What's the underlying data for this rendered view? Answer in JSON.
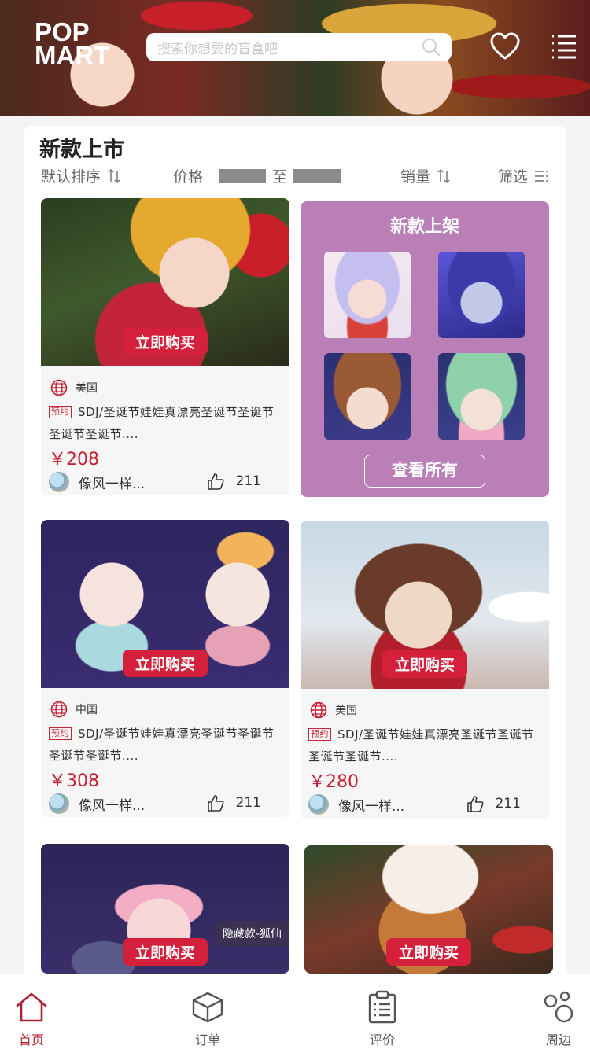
{
  "header": {
    "logo_line1": "POP",
    "logo_line2": "MART",
    "search_placeholder": "搜索你想要的盲盒吧",
    "icons": [
      "search-icon",
      "heart-icon",
      "menu-icon"
    ]
  },
  "section": {
    "title": "新款上市"
  },
  "filters": {
    "default_sort": "默认排序",
    "price": "价格",
    "price_to": "至",
    "sales": "销量",
    "filter": "筛选"
  },
  "products": [
    {
      "country": "美国",
      "tag": "预约",
      "description": "SDJ/圣诞节娃娃真漂亮圣诞节圣诞节圣诞节圣诞节....",
      "price": "￥208",
      "user": "像风一样...",
      "likes": "211",
      "buy_label": "立即购买"
    },
    {
      "country": "中国",
      "tag": "预约",
      "description": "SDJ/圣诞节娃娃真漂亮圣诞节圣诞节圣诞节圣诞节....",
      "price": "￥308",
      "user": "像风一样...",
      "likes": "211",
      "buy_label": "立即购买"
    },
    {
      "country": "美国",
      "tag": "预约",
      "description": "SDJ/圣诞节娃娃真漂亮圣诞节圣诞节圣诞节圣诞节....",
      "price": "￥280",
      "user": "像风一样...",
      "likes": "211",
      "buy_label": "立即购买"
    },
    {
      "buy_label": "立即购买",
      "badge": "隐藏款-狐仙"
    },
    {
      "buy_label": "立即购买"
    }
  ],
  "promo": {
    "title": "新款上架",
    "view_all": "查看所有"
  },
  "tabbar": {
    "items": [
      {
        "label": "首页",
        "icon": "home-icon",
        "active": true
      },
      {
        "label": "订单",
        "icon": "box-icon",
        "active": false
      },
      {
        "label": "评价",
        "icon": "clipboard-icon",
        "active": false
      },
      {
        "label": "周边",
        "icon": "circles-icon",
        "active": false
      }
    ]
  },
  "colors": {
    "accent": "#d4203a",
    "price": "#c41f32",
    "promo_bg": "#b97fb6",
    "tab_active": "#b0202e"
  }
}
